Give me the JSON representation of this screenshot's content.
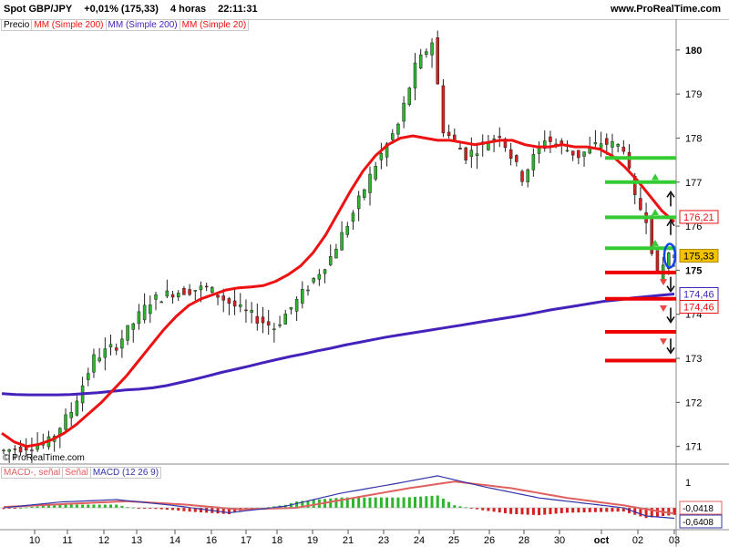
{
  "header": {
    "symbol": "Spot GBP/JPY",
    "change": "+0,01% (175,33)",
    "timeframe": "4 horas",
    "time": "22:11:31",
    "site": "www.ProRealTime.com"
  },
  "legend": {
    "price": "Precio",
    "ma200_red": "MM (Simple 200)",
    "ma200_blue": "MM (Simple 200)",
    "ma20": "MM (Simple 20)"
  },
  "copyright": "© ProRealTime.com",
  "macd_legend": {
    "macd_signal": "MACD-, señal",
    "signal": "Señal",
    "macd": "MACD (12 26 9)"
  },
  "colors": {
    "up": "#2db52d",
    "down": "#d62020",
    "ma20": "#ee1111",
    "ma200": "#4422bb",
    "level_green": "#33cc33",
    "level_red": "#ee0000"
  },
  "chart_data": [
    {
      "type": "candlestick",
      "title": "Spot GBP/JPY",
      "x_tick_labels": [
        "10",
        "11",
        "12",
        "13",
        "14",
        "16",
        "17",
        "18",
        "19",
        "21",
        "23",
        "24",
        "25",
        "26",
        "28",
        "30",
        "oct",
        "02",
        "03"
      ],
      "y_ticks": [
        171,
        172,
        173,
        174,
        175,
        176,
        177,
        178,
        179,
        180
      ],
      "y_tick_labels": [
        "171",
        "172",
        "173",
        "174",
        "175",
        "176",
        "177",
        "178",
        "179",
        "180"
      ],
      "ylim": [
        170.6,
        180.7
      ],
      "grid": false,
      "series": [
        {
          "name": "MM (Simple 20)",
          "values": [
            171.3,
            171.1,
            171.0,
            171.05,
            171.15,
            171.3,
            171.5,
            171.75,
            172.0,
            172.3,
            172.6,
            172.95,
            173.3,
            173.65,
            173.95,
            174.2,
            174.35,
            174.45,
            174.55,
            174.6,
            174.62,
            174.65,
            174.75,
            174.9,
            175.1,
            175.4,
            175.8,
            176.3,
            176.8,
            177.25,
            177.6,
            177.85,
            178.0,
            178.05,
            178.0,
            177.95,
            177.95,
            177.9,
            177.85,
            177.9,
            177.95,
            177.95,
            177.85,
            177.8,
            177.8,
            177.85,
            177.8,
            177.8,
            177.75,
            177.6,
            177.35,
            177.05,
            176.7,
            176.35,
            176.1
          ]
        },
        {
          "name": "MM (Simple 200)",
          "values": [
            172.2,
            172.18,
            172.17,
            172.17,
            172.17,
            172.18,
            172.2,
            172.22,
            172.25,
            172.28,
            172.3,
            172.33,
            172.38,
            172.45,
            172.52,
            172.6,
            172.68,
            172.75,
            172.82,
            172.9,
            172.97,
            173.04,
            173.1,
            173.17,
            173.23,
            173.3,
            173.36,
            173.42,
            173.48,
            173.53,
            173.58,
            173.63,
            173.68,
            173.73,
            173.78,
            173.83,
            173.88,
            173.93,
            173.98,
            174.04,
            174.1,
            174.15,
            174.2,
            174.25,
            174.3,
            174.33,
            174.37,
            174.4,
            174.43,
            174.46
          ]
        }
      ],
      "price_labels": [
        {
          "value": 176.21,
          "label": "176,21",
          "color": "#ee1111"
        },
        {
          "value": 175.33,
          "label": "175,33",
          "color": "#f2c200"
        },
        {
          "value": 174.46,
          "label": "174,46",
          "color": "#4422bb"
        },
        {
          "value": 174.46,
          "label": "174,46",
          "color": "#ee1111"
        }
      ],
      "levels": [
        {
          "value": 177.55,
          "color": "green"
        },
        {
          "value": 177.0,
          "color": "green"
        },
        {
          "value": 176.2,
          "color": "green"
        },
        {
          "value": 175.5,
          "color": "green"
        },
        {
          "value": 174.95,
          "color": "red"
        },
        {
          "value": 174.35,
          "color": "red"
        },
        {
          "value": 173.6,
          "color": "red"
        },
        {
          "value": 172.95,
          "color": "red"
        }
      ]
    },
    {
      "type": "bar",
      "title": "MACD (12 26 9)",
      "y_tick_labels": [
        "1"
      ],
      "value_labels": [
        "-0,0418",
        "-0,6408"
      ]
    }
  ]
}
